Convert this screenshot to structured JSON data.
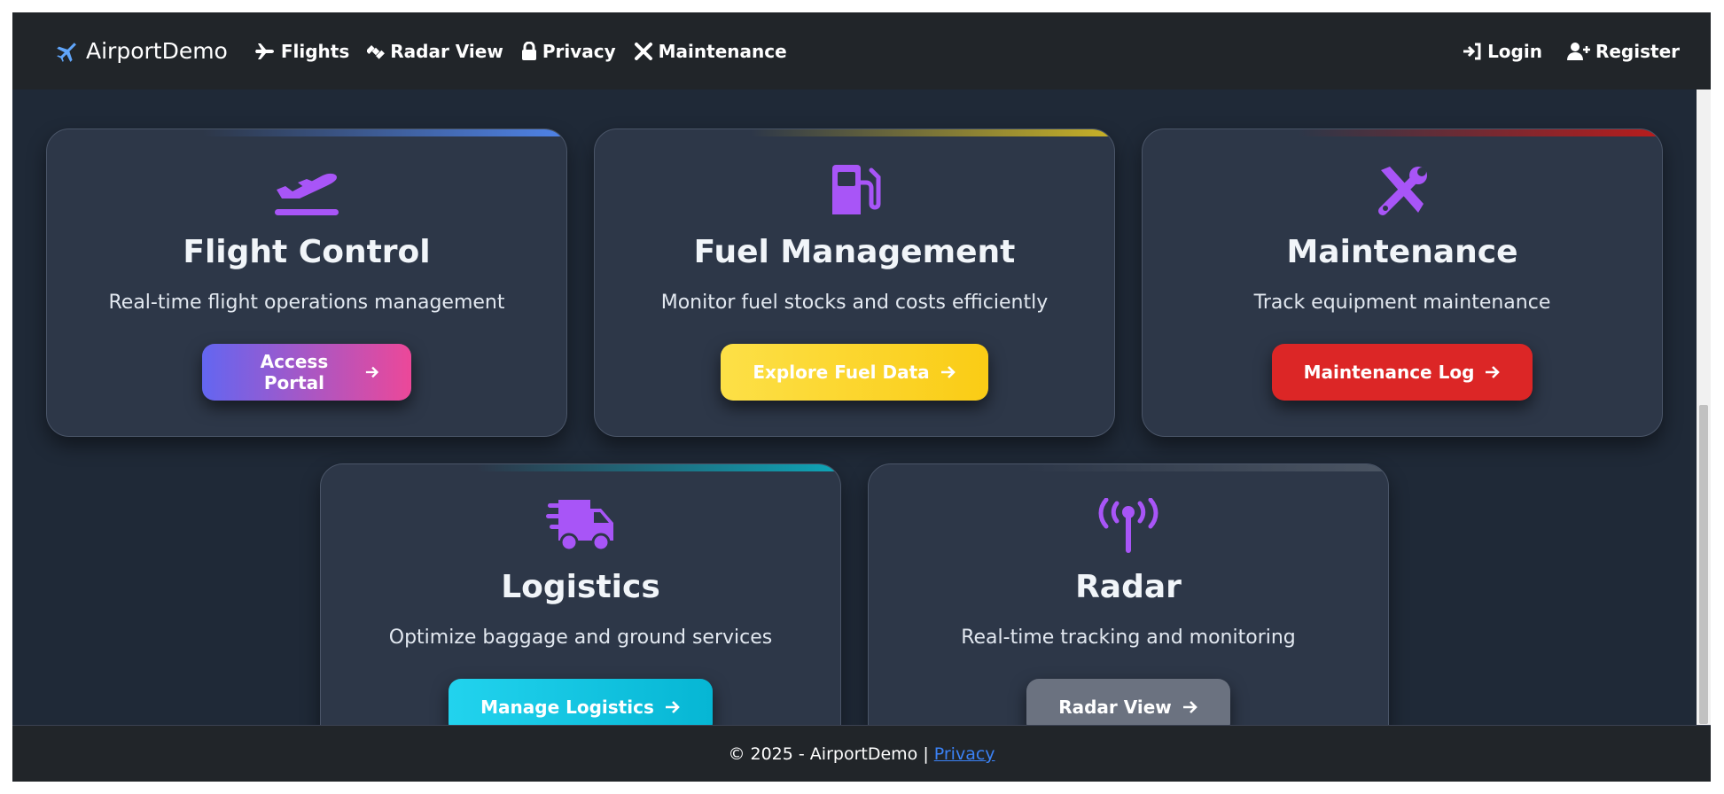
{
  "navbar": {
    "brand": "AirportDemo",
    "links": [
      {
        "label": "Flights",
        "icon": "plane-icon"
      },
      {
        "label": "Radar View",
        "icon": "satellite-icon"
      },
      {
        "label": "Privacy",
        "icon": "lock-icon"
      },
      {
        "label": "Maintenance",
        "icon": "tools-icon"
      }
    ],
    "right": [
      {
        "label": "Login",
        "icon": "sign-in-icon"
      },
      {
        "label": "Register",
        "icon": "user-plus-icon"
      }
    ]
  },
  "cards": [
    {
      "title": "Flight Control",
      "description": "Real-time flight operations management",
      "button": "Access Portal",
      "icon": "plane-departure-icon",
      "accent": "#4f83e8",
      "button_colors": [
        "#6366f1",
        "#ec4899"
      ]
    },
    {
      "title": "Fuel Management",
      "description": "Monitor fuel stocks and costs efficiently",
      "button": "Explore Fuel Data",
      "icon": "gas-pump-icon",
      "accent": "#c9b227",
      "button_colors": [
        "#fde047",
        "#facc15"
      ]
    },
    {
      "title": "Maintenance",
      "description": "Track equipment maintenance",
      "button": "Maintenance Log",
      "icon": "tools-icon",
      "accent": "#b91c1c",
      "button_colors": [
        "#dc2626",
        "#dc2626"
      ]
    },
    {
      "title": "Logistics",
      "description": "Optimize baggage and ground services",
      "button": "Manage Logistics",
      "icon": "truck-fast-icon",
      "accent": "#0ea5b7",
      "button_colors": [
        "#22d3ee",
        "#06b6d4"
      ]
    },
    {
      "title": "Radar",
      "description": "Real-time tracking and monitoring",
      "button": "Radar View",
      "icon": "tower-broadcast-icon",
      "accent": "#4b5563",
      "button_colors": [
        "#6b7280",
        "#6b7280"
      ]
    }
  ],
  "footer": {
    "text": "© 2025 - AirportDemo |",
    "link": "Privacy"
  },
  "colors": {
    "icon_purple": "#a855f7",
    "background": "#1f2937",
    "card": "#2d3748",
    "navbar": "#212529"
  }
}
